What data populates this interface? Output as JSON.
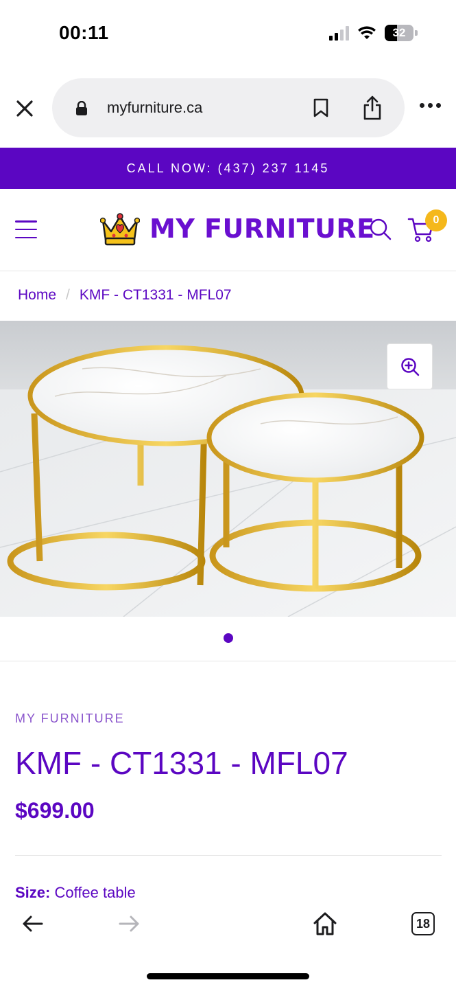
{
  "status_bar": {
    "time": "00:11",
    "battery": "32"
  },
  "browser": {
    "url": "myfurniture.ca",
    "tab_count": "18"
  },
  "promo": {
    "text": "CALL NOW: (437) 237 1145"
  },
  "header": {
    "logo_text": "MY FURNITURE",
    "cart_count": "0"
  },
  "breadcrumb": {
    "home": "Home",
    "separator": "/",
    "current": "KMF - CT1331 - MFL07"
  },
  "product": {
    "vendor": "MY FURNITURE",
    "title": "KMF - CT1331 - MFL07",
    "price": "$699.00",
    "size_label": "Size:",
    "size_value": "Coffee table",
    "image_count": 1,
    "current_image": 1
  },
  "colors": {
    "brand": "#5b06c2",
    "badge": "#f5b81b"
  },
  "icons": [
    "close-icon",
    "lock-icon",
    "bookmark-icon",
    "share-icon",
    "more-icon",
    "menu-icon",
    "crown-icon",
    "search-icon",
    "cart-icon",
    "zoom-in-icon",
    "back-icon",
    "forward-icon",
    "home-icon",
    "tabs-icon"
  ]
}
